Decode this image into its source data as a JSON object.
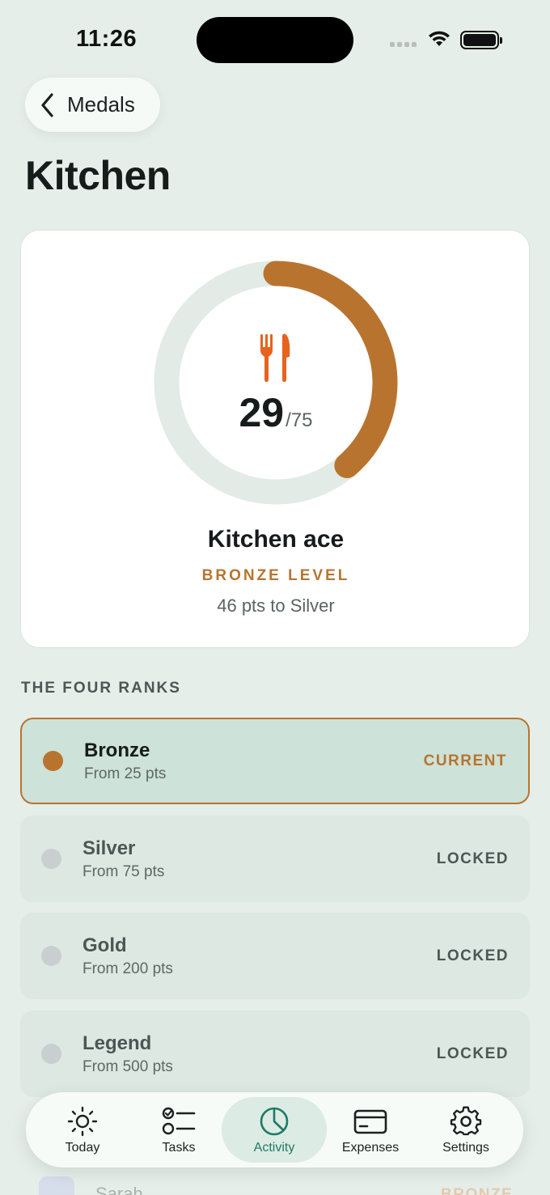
{
  "status_bar": {
    "time": "11:26"
  },
  "nav": {
    "back_label": "Medals"
  },
  "page": {
    "title": "Kitchen"
  },
  "hero": {
    "icon": "fork-knife-icon",
    "points": "29",
    "goal": "/75",
    "progress_fraction": 0.387,
    "medal_name": "Kitchen ace",
    "level": "BRONZE LEVEL",
    "pts_to_next": "46 pts to Silver",
    "colors": {
      "accent": "#b8742f",
      "icon": "#e8621e",
      "track": "#e2ebe6"
    }
  },
  "ranks_section": {
    "title": "THE FOUR RANKS",
    "ranks": [
      {
        "name": "Bronze",
        "threshold": "From 25 pts",
        "status": "CURRENT"
      },
      {
        "name": "Silver",
        "threshold": "From 75 pts",
        "status": "LOCKED"
      },
      {
        "name": "Gold",
        "threshold": "From 200 pts",
        "status": "LOCKED"
      },
      {
        "name": "Legend",
        "threshold": "From 500 pts",
        "status": "LOCKED"
      }
    ]
  },
  "below_fold": {
    "row_name": "Sarah",
    "row_status": "BRONZE"
  },
  "tabbar": {
    "tabs": [
      {
        "label": "Today",
        "icon": "sun-icon"
      },
      {
        "label": "Tasks",
        "icon": "checklist-icon"
      },
      {
        "label": "Activity",
        "icon": "pie-chart-icon",
        "active": true
      },
      {
        "label": "Expenses",
        "icon": "credit-card-icon"
      },
      {
        "label": "Settings",
        "icon": "gear-icon"
      }
    ]
  }
}
